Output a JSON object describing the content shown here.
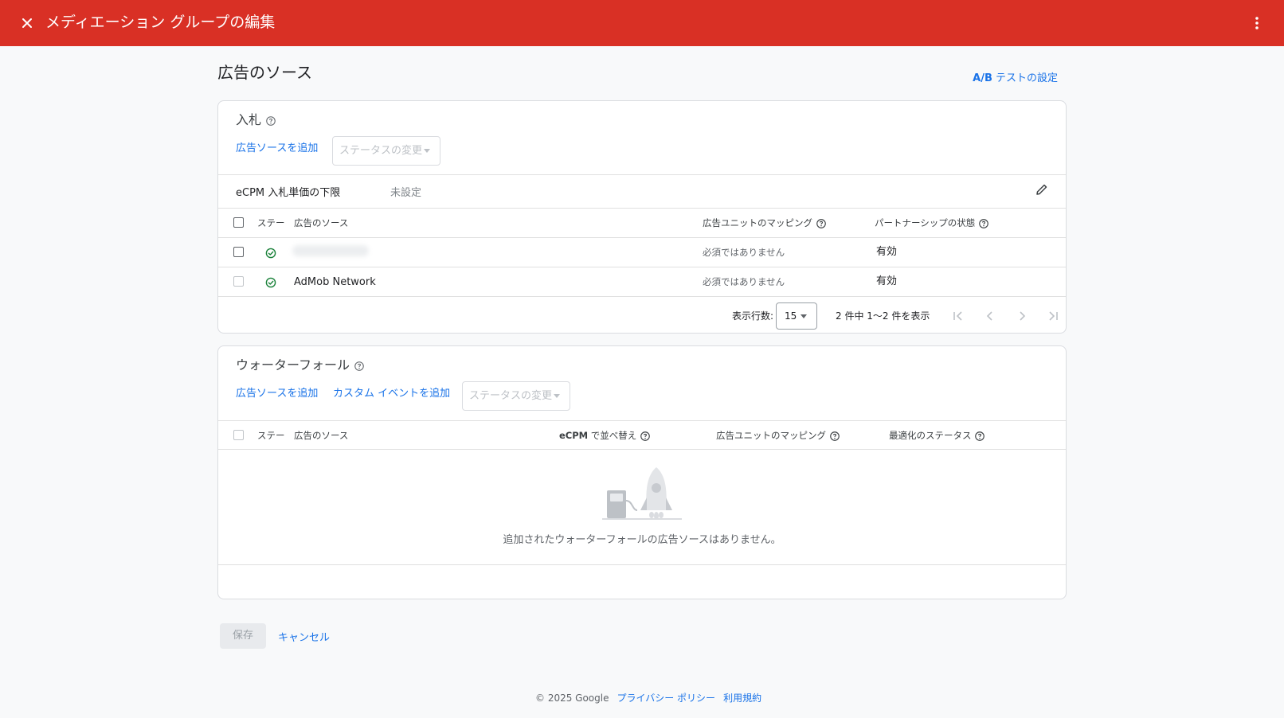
{
  "header": {
    "title": "メディエーション グループの編集",
    "close_icon": "close-icon",
    "more_icon": "more-vert-icon",
    "bg_color": "#d93025"
  },
  "page": {
    "title": "広告のソース",
    "ab_link_prefix": "A/B",
    "ab_link_suffix": " テストの設定"
  },
  "bidding": {
    "title": "入札",
    "add_source_label": "広告ソースを追加",
    "status_change_label": "ステータスの変更",
    "floor_label": "eCPM 入札単価の下限",
    "floor_value": "未設定",
    "columns": [
      "ステー",
      "広告のソース",
      "広告ユニットのマッピング",
      "パートナーシップの状態"
    ],
    "rows": [
      {
        "name": "",
        "mapping": "必須ではありません",
        "partnership": "有効"
      },
      {
        "name": "AdMob Network",
        "mapping": "必須ではありません",
        "partnership": "有効"
      }
    ],
    "pager": {
      "rows_label": "表示行数:",
      "rows_value": "15",
      "range_text": "2 件中 1〜2 件を表示"
    }
  },
  "waterfall": {
    "title": "ウォーターフォール",
    "add_source_label": "広告ソースを追加",
    "add_custom_event_label": "カスタム イベントを追加",
    "status_change_label": "ステータスの変更",
    "columns": [
      "ステー",
      "広告のソース",
      "eCPM",
      " で並べ替え",
      "広告ユニットのマッピング",
      "最適化のステータス"
    ],
    "empty_text": "追加されたウォーターフォールの広告ソースはありません。"
  },
  "actions": {
    "save_label": "保存",
    "cancel_label": "キャンセル"
  },
  "footer": {
    "copyright": "© 2025 Google",
    "privacy": "プライバシー ポリシー",
    "terms": "利用規約"
  },
  "colors": {
    "link": "#1a73e8",
    "success": "#188038"
  }
}
